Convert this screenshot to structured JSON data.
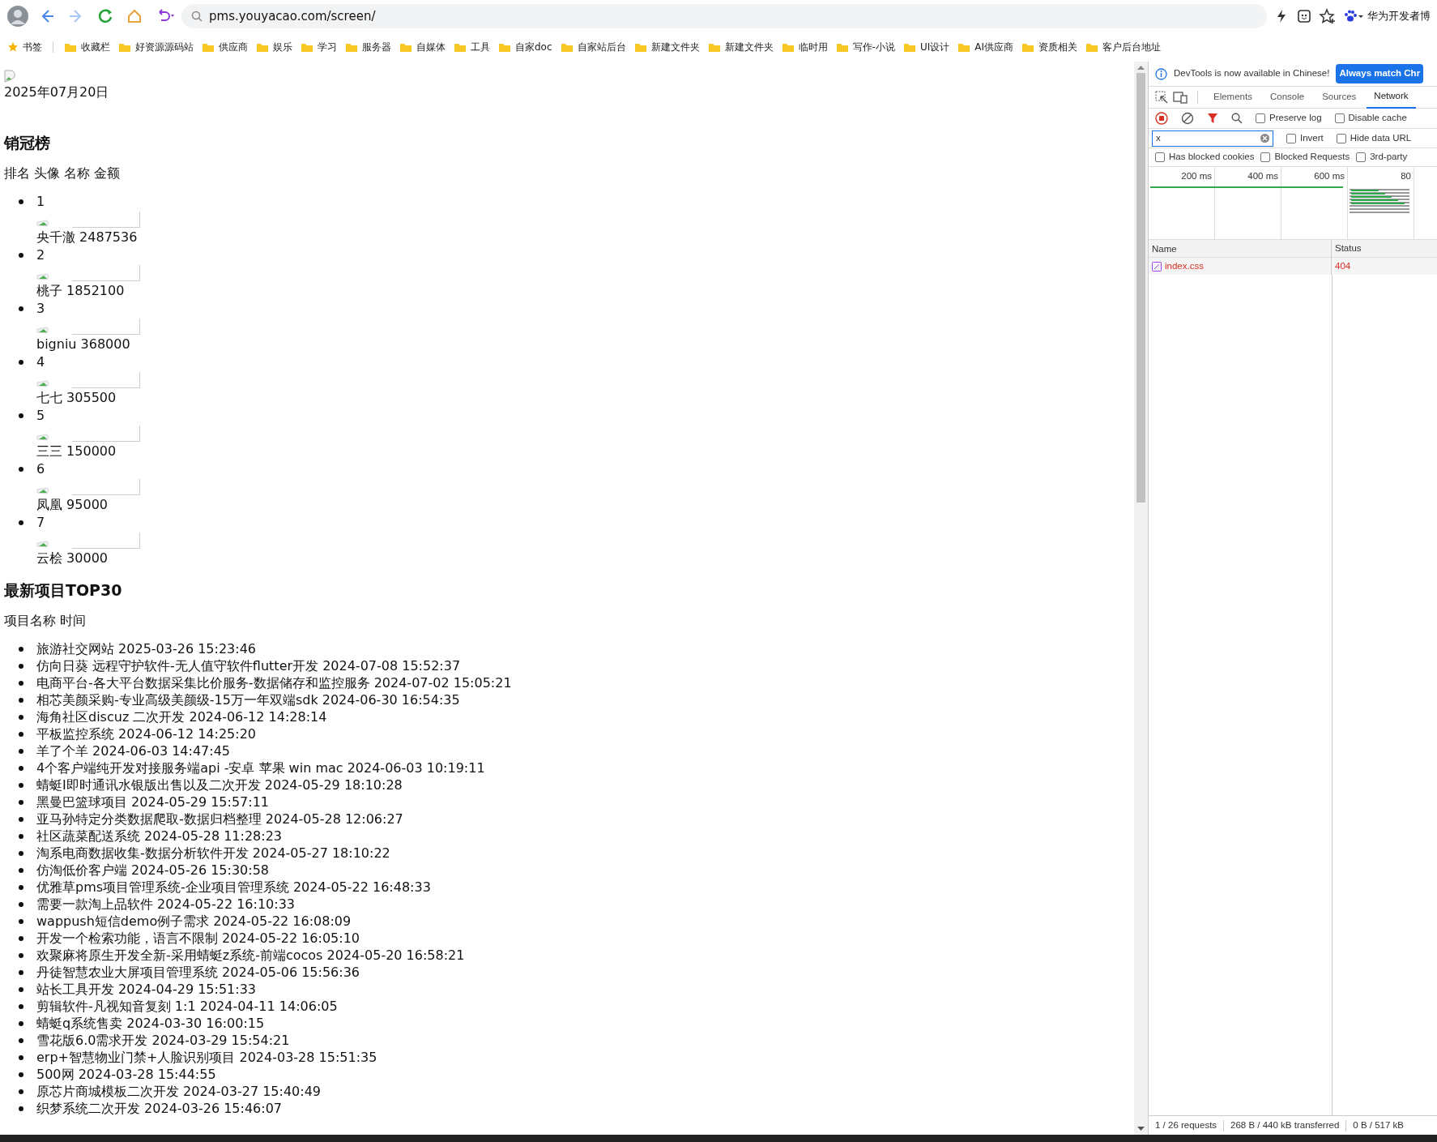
{
  "browser": {
    "address": "pms.youyacao.com/screen/",
    "profile_label": "华为开发者博"
  },
  "bookmarks": [
    {
      "label": "书签",
      "kind": "star"
    },
    {
      "label": "收藏栏",
      "kind": "folder"
    },
    {
      "label": "好资源源码站",
      "kind": "folder"
    },
    {
      "label": "供应商",
      "kind": "folder"
    },
    {
      "label": "娱乐",
      "kind": "folder"
    },
    {
      "label": "学习",
      "kind": "folder"
    },
    {
      "label": "服务器",
      "kind": "folder"
    },
    {
      "label": "自媒体",
      "kind": "folder"
    },
    {
      "label": "工具",
      "kind": "folder"
    },
    {
      "label": "自家doc",
      "kind": "folder"
    },
    {
      "label": "自家站后台",
      "kind": "folder"
    },
    {
      "label": "新建文件夹",
      "kind": "folder"
    },
    {
      "label": "新建文件夹",
      "kind": "folder"
    },
    {
      "label": "临时用",
      "kind": "folder"
    },
    {
      "label": "写作-小说",
      "kind": "folder"
    },
    {
      "label": "UI设计",
      "kind": "folder"
    },
    {
      "label": "AI供应商",
      "kind": "folder"
    },
    {
      "label": "资质相关",
      "kind": "folder"
    },
    {
      "label": "客户后台地址",
      "kind": "folder"
    }
  ],
  "page": {
    "date": "2025年07月20日",
    "ranking": {
      "title": "销冠榜",
      "header": "排名 头像 名称 金额",
      "items": [
        {
          "rank": "1",
          "name": "央千澈",
          "amount": "2487536"
        },
        {
          "rank": "2",
          "name": "桃子",
          "amount": "1852100"
        },
        {
          "rank": "3",
          "name": "bigniu",
          "amount": "368000"
        },
        {
          "rank": "4",
          "name": "七七",
          "amount": "305500"
        },
        {
          "rank": "5",
          "name": "三三",
          "amount": "150000"
        },
        {
          "rank": "6",
          "name": "凤凰",
          "amount": "95000"
        },
        {
          "rank": "7",
          "name": "云桧",
          "amount": "30000"
        }
      ]
    },
    "projects": {
      "title": "最新项目TOP30",
      "header": "项目名称 时间",
      "items": [
        {
          "name": "旅游社交网站",
          "time": "2025-03-26 15:23:46"
        },
        {
          "name": "仿向日葵 远程守护软件-无人值守软件flutter开发",
          "time": "2024-07-08 15:52:37"
        },
        {
          "name": "电商平台-各大平台数据采集比价服务-数据储存和监控服务",
          "time": "2024-07-02 15:05:21"
        },
        {
          "name": "相芯美颜采购-专业高级美颜级-15万一年双端sdk",
          "time": "2024-06-30 16:54:35"
        },
        {
          "name": "海角社区discuz 二次开发",
          "time": "2024-06-12 14:28:14"
        },
        {
          "name": "平板监控系统",
          "time": "2024-06-12 14:25:20"
        },
        {
          "name": "羊了个羊",
          "time": "2024-06-03 14:47:45"
        },
        {
          "name": "4个客户端纯开发对接服务端api -安卓 苹果 win mac",
          "time": "2024-06-03 10:19:11"
        },
        {
          "name": "蜻蜓I即时通讯水银版出售以及二次开发",
          "time": "2024-05-29 18:10:28"
        },
        {
          "name": "黑曼巴篮球项目",
          "time": "2024-05-29 15:57:11"
        },
        {
          "name": "亚马孙特定分类数据爬取-数据归档整理",
          "time": "2024-05-28 12:06:27"
        },
        {
          "name": "社区蔬菜配送系统",
          "time": "2024-05-28 11:28:23"
        },
        {
          "name": "淘系电商数据收集-数据分析软件开发",
          "time": "2024-05-27 18:10:22"
        },
        {
          "name": "仿淘低价客户端",
          "time": "2024-05-26 15:30:58"
        },
        {
          "name": "优雅草pms项目管理系统-企业项目管理系统",
          "time": "2024-05-22 16:48:33"
        },
        {
          "name": "需要一款淘上品软件",
          "time": "2024-05-22 16:10:33"
        },
        {
          "name": "wappush短信demo例子需求",
          "time": "2024-05-22 16:08:09"
        },
        {
          "name": "开发一个检索功能，语言不限制",
          "time": "2024-05-22 16:05:10"
        },
        {
          "name": "欢聚麻将原生开发全新-采用蜻蜓z系统-前端cocos",
          "time": "2024-05-20 16:58:21"
        },
        {
          "name": "丹徒智慧农业大屏项目管理系统",
          "time": "2024-05-06 15:56:36"
        },
        {
          "name": "站长工具开发",
          "time": "2024-04-29 15:51:33"
        },
        {
          "name": "剪辑软件-凡视知音复刻 1:1",
          "time": "2024-04-11 14:06:05"
        },
        {
          "name": "蜻蜓q系统售卖",
          "time": "2024-03-30 16:00:15"
        },
        {
          "name": "雪花版6.0需求开发",
          "time": "2024-03-29 15:54:21"
        },
        {
          "name": "erp+智慧物业门禁+人脸识别项目",
          "time": "2024-03-28 15:51:35"
        },
        {
          "name": "500网",
          "time": "2024-03-28 15:44:55"
        },
        {
          "name": "原芯片商城模板二次开发",
          "time": "2024-03-27 15:40:49"
        },
        {
          "name": "织梦系统二次开发",
          "time": "2024-03-26 15:46:07"
        }
      ]
    }
  },
  "devtools": {
    "banner": {
      "message": "DevTools is now available in Chinese!",
      "button": "Always match Chr"
    },
    "tabs": [
      {
        "label": "Elements",
        "selected": false
      },
      {
        "label": "Console",
        "selected": false
      },
      {
        "label": "Sources",
        "selected": false
      },
      {
        "label": "Network",
        "selected": true
      }
    ],
    "recording": true,
    "filter": {
      "value": "x"
    },
    "toolbar_checks": [
      {
        "label": "Preserve log",
        "checked": false
      },
      {
        "label": "Disable cache",
        "checked": false
      }
    ],
    "filter_checks": [
      {
        "label": "Invert",
        "checked": false
      },
      {
        "label": "Hide data URL",
        "checked": false
      }
    ],
    "request_checks": [
      {
        "label": "Has blocked cookies",
        "checked": false
      },
      {
        "label": "Blocked Requests",
        "checked": false
      },
      {
        "label": "3rd-party",
        "checked": false
      }
    ],
    "timeline_ticks": [
      "200 ms",
      "400 ms",
      "600 ms",
      "80"
    ],
    "table": {
      "columns": [
        "Name",
        "Status"
      ],
      "rows": [
        {
          "name": "index.css",
          "status": "404",
          "failed": true
        }
      ]
    },
    "status_bar": [
      "1 / 26 requests",
      "268 B / 440 kB transferred",
      "0 B / 517 kB"
    ]
  }
}
